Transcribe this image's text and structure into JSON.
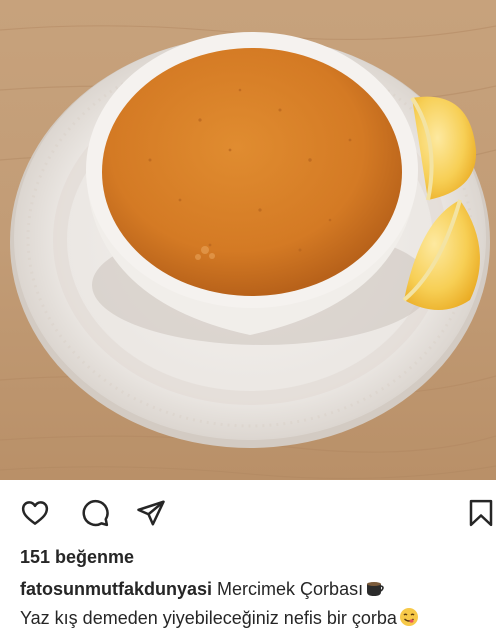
{
  "post": {
    "image_icon": "photo-soup-bowl",
    "likes_text": "151 beğenme",
    "username": "fatosunmutfakdunyasi",
    "caption_title": "Mercimek Çorbası",
    "caption_line2": "Yaz kış demeden yiyebileceğiniz nefis bir çorba"
  },
  "actions": {
    "like_icon": "heart-icon",
    "comment_icon": "comment-icon",
    "share_icon": "paper-plane-icon",
    "save_icon": "bookmark-icon"
  },
  "colors": {
    "text": "#262626",
    "soup": "#d9822b",
    "lemon": "#f6c642",
    "wood": "#c9a27a"
  }
}
